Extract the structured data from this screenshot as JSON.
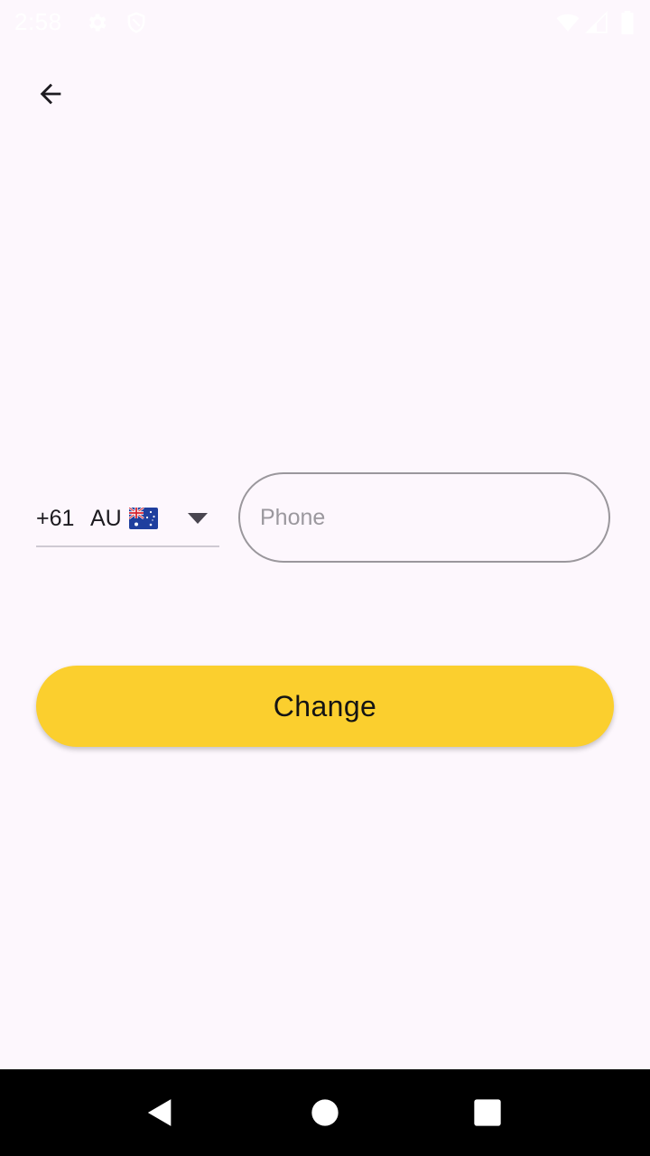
{
  "status_bar": {
    "time": "2:58",
    "icons": [
      "gear-icon",
      "shield-icon",
      "wifi-icon",
      "signal-icon",
      "battery-icon"
    ]
  },
  "header": {
    "back_icon": "arrow-left-icon"
  },
  "phone_form": {
    "country_code": "+61",
    "country_iso": "AU",
    "flag_icon": "australia-flag-icon",
    "dropdown_icon": "triangle-down-icon",
    "phone_placeholder": "Phone",
    "phone_value": ""
  },
  "actions": {
    "change_label": "Change"
  },
  "nav_bar": {
    "icons": [
      "back-triangle-icon",
      "home-circle-icon",
      "recents-square-icon"
    ]
  },
  "colors": {
    "background": "#fdf7fd",
    "accent": "#fbcf2e",
    "text": "#1d1b20",
    "outline": "#9a979c"
  }
}
